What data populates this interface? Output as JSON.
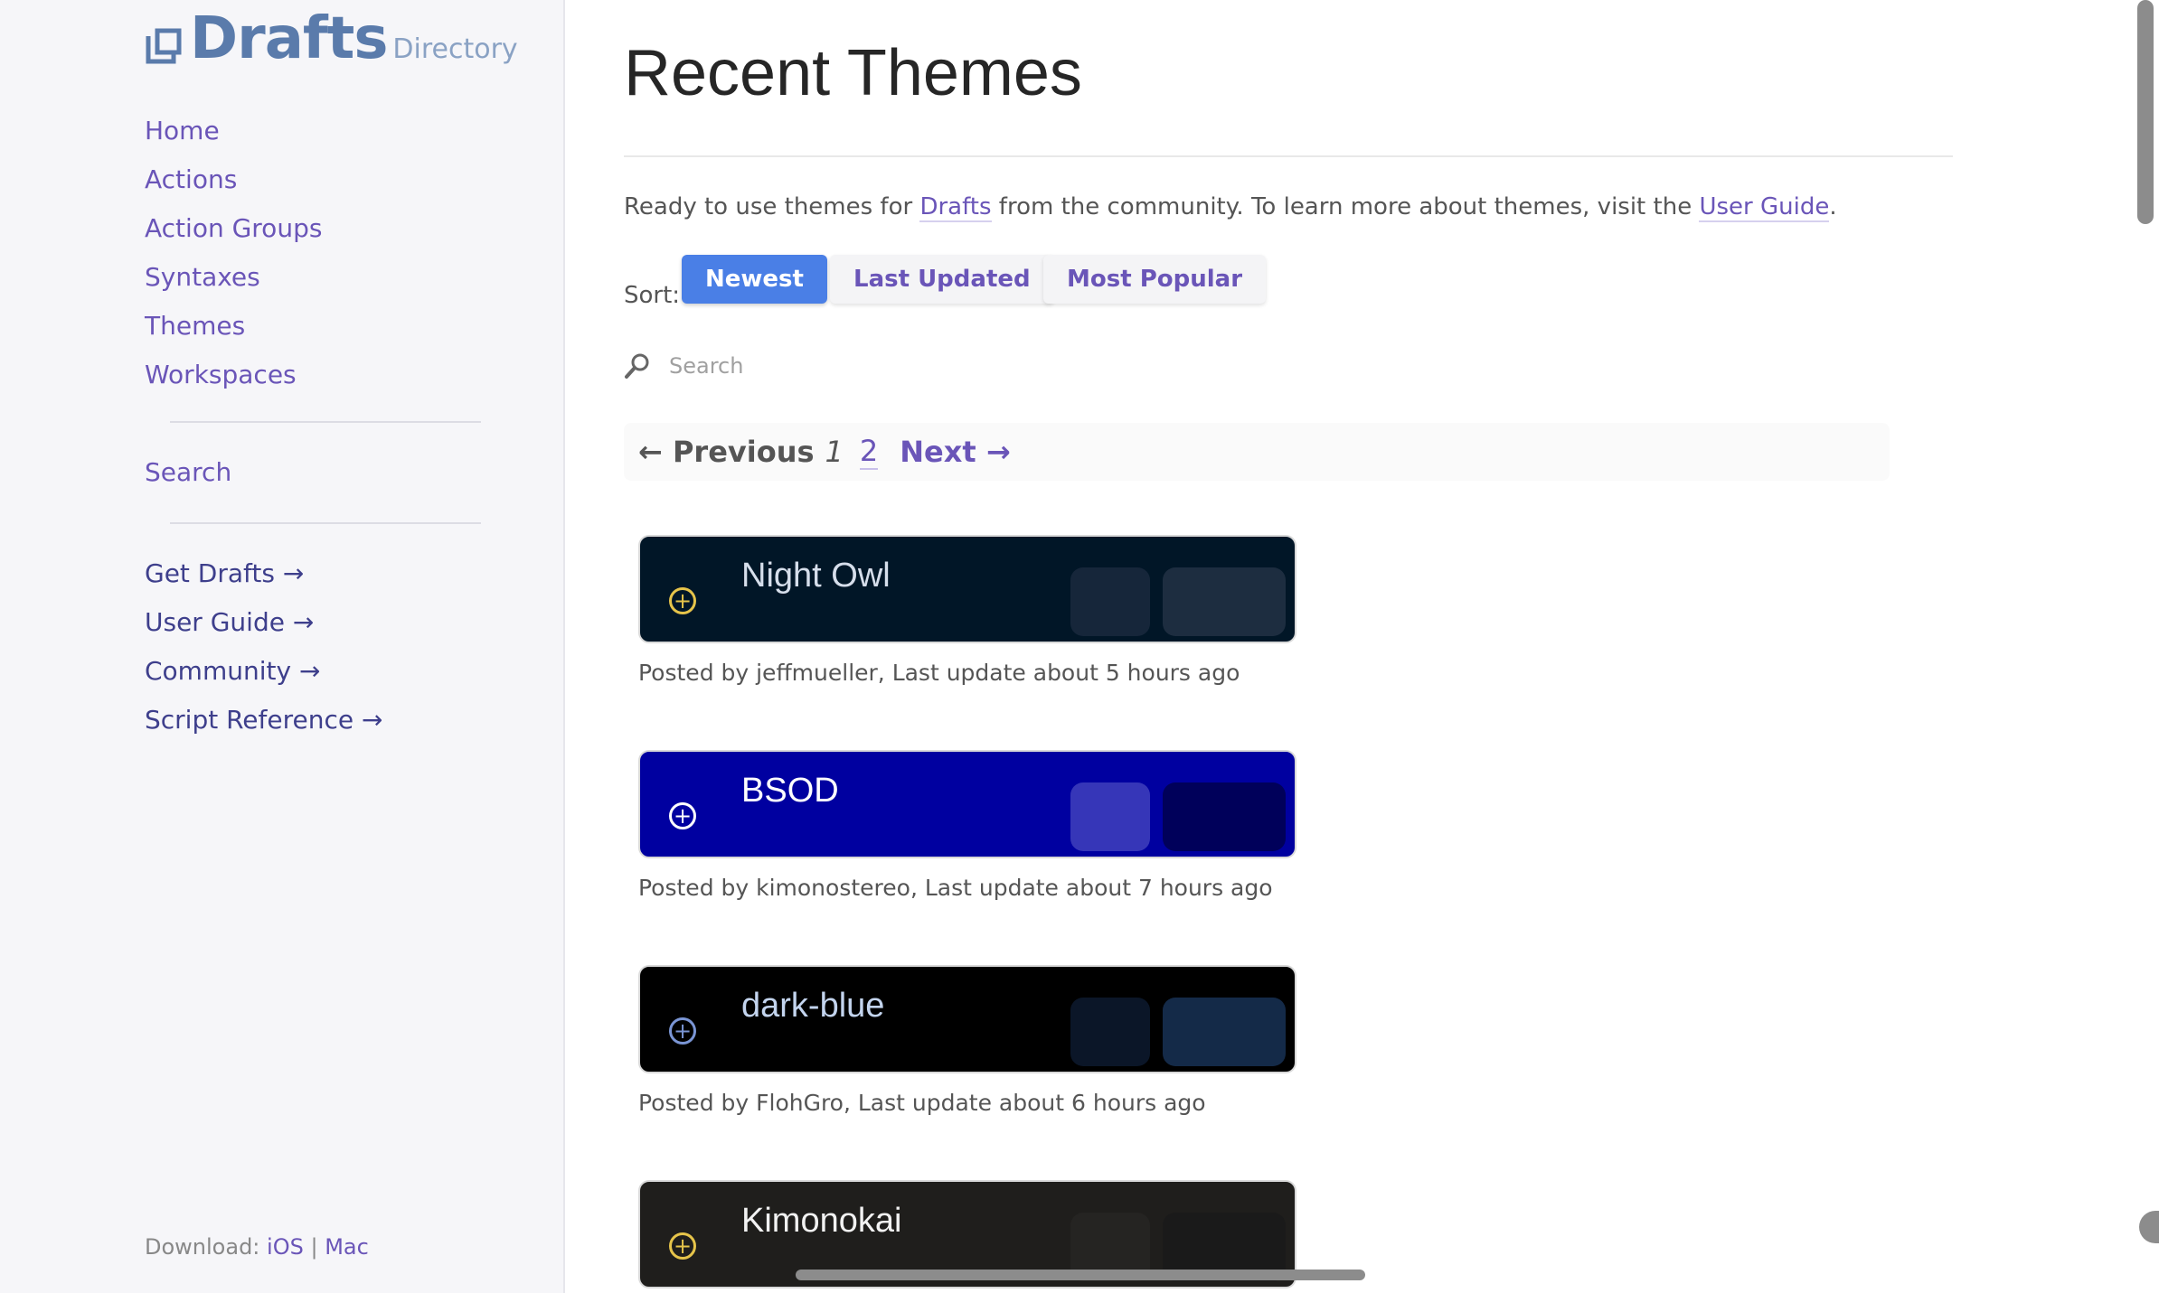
{
  "sidebar": {
    "logo_word": "Drafts",
    "logo_sub": "Directory",
    "nav": [
      "Home",
      "Actions",
      "Action Groups",
      "Syntaxes",
      "Themes",
      "Workspaces"
    ],
    "search_label": "Search",
    "external": [
      "Get Drafts →",
      "User Guide →",
      "Community →",
      "Script Reference →"
    ],
    "download_label": "Download:",
    "download_ios": "iOS",
    "download_sep": "|",
    "download_mac": "Mac"
  },
  "main": {
    "title": "Recent Themes",
    "intro_pre": "Ready to use themes for ",
    "intro_link1": "Drafts",
    "intro_mid": " from the community. To learn more about themes, visit the ",
    "intro_link2": "User Guide",
    "intro_post": ".",
    "sort_label": "Sort:",
    "sort_newest": "Newest",
    "sort_last_updated": "Last Updated",
    "sort_popular": "Most Popular",
    "search_placeholder": "Search",
    "pager": {
      "prev": "← Previous",
      "current": "1",
      "page2": "2",
      "next": "Next →"
    },
    "themes": [
      {
        "name": "Night Owl",
        "meta": "Posted by jeffmueller, Last update about 5 hours ago",
        "bg": "#011627",
        "fg": "#d6deeb",
        "icon": "#e6c44a",
        "s1": "#16263a",
        "s2": "#1d2d40"
      },
      {
        "name": "BSOD",
        "meta": "Posted by kimonostereo, Last update about 7 hours ago",
        "bg": "#0000a0",
        "fg": "#ffffff",
        "icon": "#ffffff",
        "s1": "#3636b8",
        "s2": "#00005a"
      },
      {
        "name": "dark-blue",
        "meta": "Posted by FlohGro, Last update about 6 hours ago",
        "bg": "#000000",
        "fg": "#c3d4ee",
        "icon": "#7a95d4",
        "s1": "#0b1628",
        "s2": "#142a48"
      },
      {
        "name": "Kimonokai",
        "meta": "",
        "bg": "#1f1e1c",
        "fg": "#f2f2f2",
        "icon": "#e6c44a",
        "s1": "#252422",
        "s2": "#1a1a1a"
      }
    ]
  }
}
